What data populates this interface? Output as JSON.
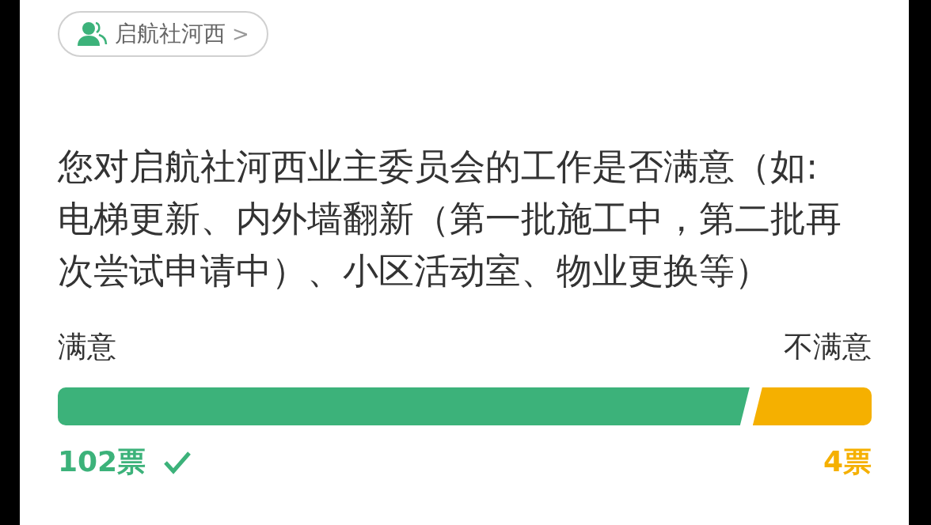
{
  "group_chip": {
    "label": "启航社河西",
    "arrow": ">"
  },
  "question": "您对启航社河西业主委员会的工作是否满意（如:电梯更新、内外墙翻新（第一批施工中，第二批再次尝试申请中）、小区活动室、物业更换等）",
  "options": [
    {
      "label": "满意",
      "votes": "102票",
      "selected": true,
      "color": "#3cb27a"
    },
    {
      "label": "不满意",
      "votes": "4票",
      "selected": false,
      "color": "#f5b000"
    }
  ]
}
